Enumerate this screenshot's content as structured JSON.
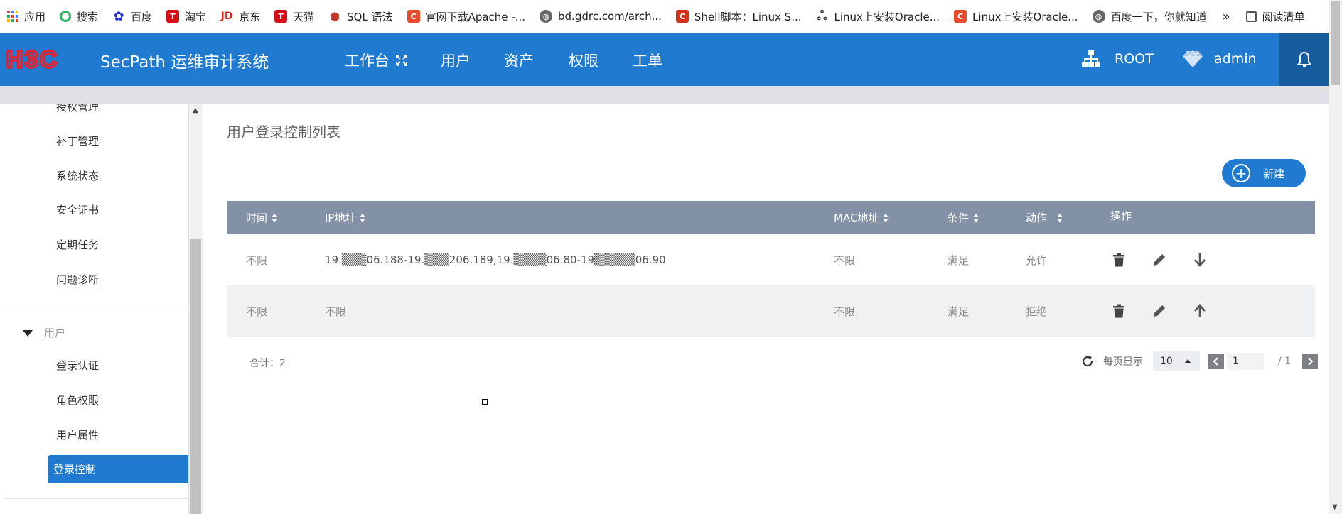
{
  "bookmarks": [
    {
      "label": "应用",
      "icon": "apps-grid-icon"
    },
    {
      "label": "搜索",
      "icon": "search-icon"
    },
    {
      "label": "百度",
      "icon": "baidu-paw-icon"
    },
    {
      "label": "淘宝",
      "icon": "tmall-icon"
    },
    {
      "label": "京东",
      "icon": "jd-icon"
    },
    {
      "label": "天猫",
      "icon": "tmall-icon"
    },
    {
      "label": "SQL 语法",
      "icon": "sql-icon"
    },
    {
      "label": "官网下载Apache -...",
      "icon": "c-logo-icon"
    },
    {
      "label": "bd.gdrc.com/arch...",
      "icon": "globe-icon"
    },
    {
      "label": "Shell脚本：Linux S...",
      "icon": "c-logo-icon"
    },
    {
      "label": "Linux上安装Oracle...",
      "icon": "oracle-icon"
    },
    {
      "label": "Linux上安装Oracle...",
      "icon": "c-logo-icon"
    },
    {
      "label": "百度一下，你就知道",
      "icon": "globe-icon"
    }
  ],
  "bookmarks_more": "»",
  "reading_list": "阅读清单",
  "header": {
    "logo_text": "H3C",
    "app_title": "SecPath 运维审计系统",
    "nav": [
      "工作台",
      "用户",
      "资产",
      "权限",
      "工单"
    ],
    "org": "ROOT",
    "user": "admin"
  },
  "sidebar": {
    "top_items": [
      "授权管理",
      "补丁管理",
      "系统状态",
      "安全证书",
      "定期任务",
      "问题诊断"
    ],
    "group": "用户",
    "group_items": [
      "登录认证",
      "角色权限",
      "用户属性"
    ],
    "active_item": "登录控制"
  },
  "main": {
    "title": "用户登录控制列表",
    "new_button": "新建",
    "columns": [
      "时间",
      "IP地址",
      "MAC地址",
      "条件",
      "动作",
      "操作"
    ],
    "rows": [
      {
        "time": "不限",
        "ip": "19.▒▒▒06.188-19.▒▒▒206.189,19.▒▒▒▒06.80-19▒▒▒▒▒06.90",
        "mac": "不限",
        "cond": "满足",
        "action": "允许",
        "move": "move-down"
      },
      {
        "time": "不限",
        "ip": "不限",
        "mac": "不限",
        "cond": "满足",
        "action": "拒绝",
        "move": "move-up"
      }
    ],
    "total": "合计：2",
    "pager": {
      "per_page_label": "每页显示",
      "page_size": "10",
      "current_page": "1",
      "total_pages": "/ 1"
    }
  },
  "colors": {
    "header": "#1f7ad0",
    "table_header": "#8391a6",
    "active": "#1f7ad0"
  }
}
